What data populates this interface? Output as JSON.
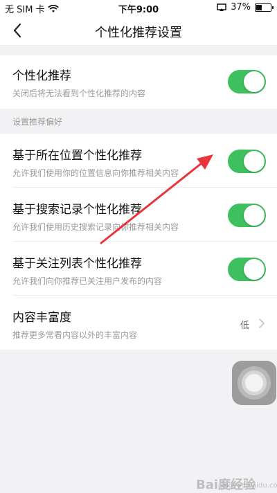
{
  "status_bar": {
    "carrier": "无 SIM 卡",
    "time": "下午9:00",
    "battery": "37%",
    "battery_level": 0.37
  },
  "nav": {
    "title": "个性化推荐设置",
    "back_icon": "chevron-left-icon"
  },
  "personalized": {
    "label": "个性化推荐",
    "desc": "关闭后将无法看到个性化推荐的内容",
    "enabled": true
  },
  "section_header": "设置推荐偏好",
  "preferences": [
    {
      "label": "基于所在位置个性化推荐",
      "desc": "允许我们使用你的位置信息向你推荐相关内容",
      "enabled": true
    },
    {
      "label": "基于搜索记录个性化推荐",
      "desc": "允许我们使用历史搜索记录向你推荐相关内容",
      "enabled": true
    },
    {
      "label": "基于关注列表个性化推荐",
      "desc": "允许我们向你推荐已关注用户发布的内容",
      "enabled": true
    }
  ],
  "richness": {
    "label": "内容丰富度",
    "desc": "推荐更多常看内容以外的丰富内容",
    "value": "低"
  },
  "watermark": {
    "logo": "Bai度经验",
    "url": "jingyan.baidu.com"
  },
  "colors": {
    "toggle_on": "#3fc05f",
    "arrow": "#e8343a",
    "background": "#f2f2f5"
  }
}
